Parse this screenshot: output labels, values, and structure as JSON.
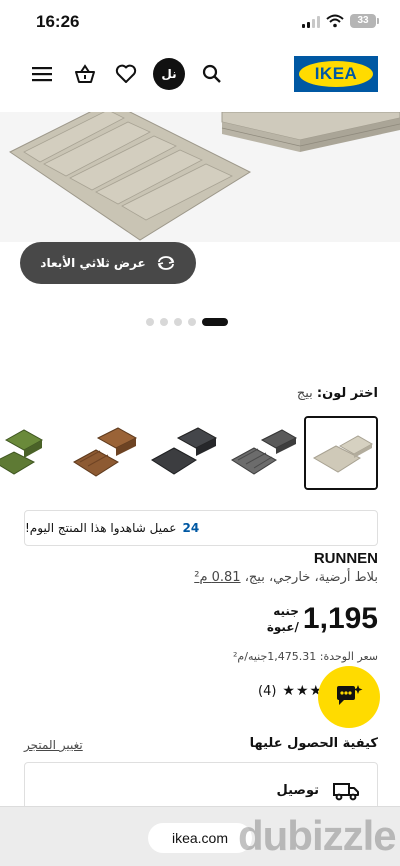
{
  "status_bar": {
    "time": "16:26",
    "battery": "33"
  },
  "header": {
    "logo_text": "IKEA",
    "user_initials": "نل",
    "icons": [
      "menu-icon",
      "basket-icon",
      "heart-icon",
      "search-icon"
    ]
  },
  "gallery": {
    "view_3d_label": "عرض ثلاثي الأبعاد",
    "dot_count": 5,
    "active_dot": 5
  },
  "color_selector": {
    "label": "اختر لون:",
    "selected": "بيج"
  },
  "viewers": {
    "count": "24",
    "text": "عميل شاهدوا هذا المنتج اليوم!"
  },
  "product": {
    "brand": "RUNNEN",
    "description_prefix": "بلاط أرضية، خارجي، بيج، ",
    "description_size": "0.81 م²",
    "price": "1,195",
    "currency": "جنيه",
    "per_pack": "/عبوة",
    "unit_price": "سعر الوحدة: 1,475.31جنيه/م²",
    "rating_count": "(4)",
    "rating_value": 4
  },
  "fulfilment": {
    "title": "كيفية الحصول عليها",
    "change_store": "تغيير المتجر",
    "delivery_label": "توصيل"
  },
  "browser": {
    "url": "ikea.com"
  },
  "watermark": {
    "text": "dubizzle"
  }
}
